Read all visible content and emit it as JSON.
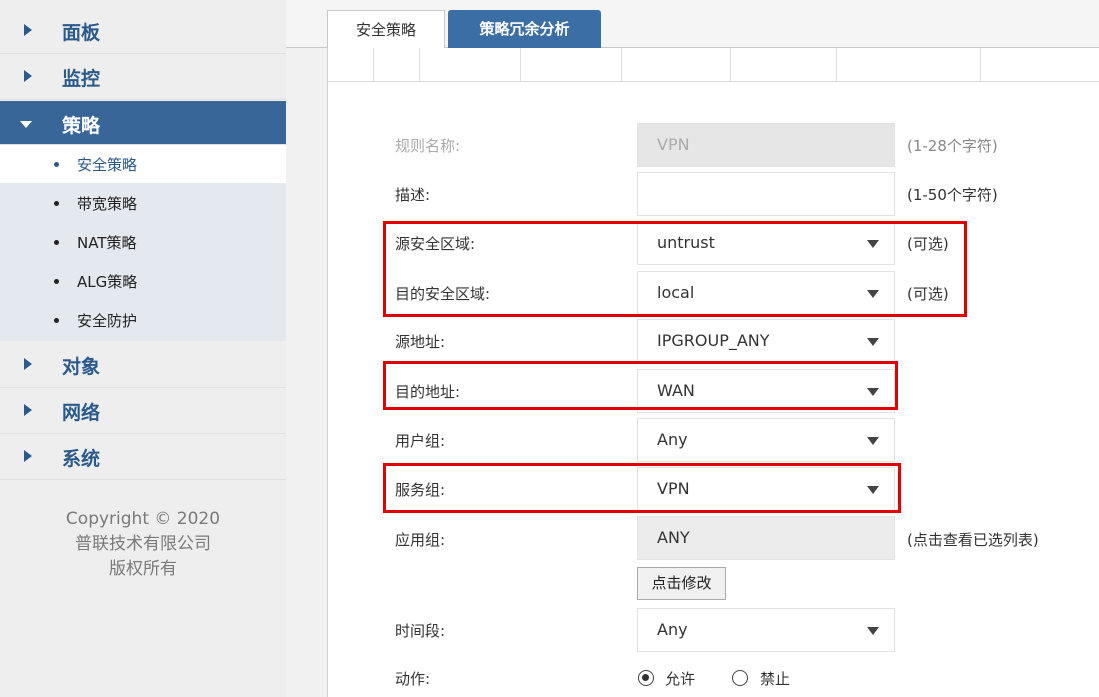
{
  "sidebar": {
    "menu": [
      {
        "label": "面板"
      },
      {
        "label": "监控"
      },
      {
        "label": "策略"
      },
      {
        "label": "对象"
      },
      {
        "label": "网络"
      },
      {
        "label": "系统"
      }
    ],
    "submenu": [
      {
        "label": "安全策略"
      },
      {
        "label": "带宽策略"
      },
      {
        "label": "NAT策略"
      },
      {
        "label": "ALG策略"
      },
      {
        "label": "安全防护"
      }
    ],
    "copyright": [
      "Copyright © 2020",
      "普联技术有限公司",
      "版权所有"
    ]
  },
  "tabs": [
    {
      "label": "安全策略"
    },
    {
      "label": "策略冗余分析"
    }
  ],
  "form": {
    "rule_name": {
      "label": "规则名称:",
      "value": "VPN",
      "hint": "(1-28个字符)"
    },
    "description": {
      "label": "描述:",
      "value": "",
      "hint": "(1-50个字符)"
    },
    "src_zone": {
      "label": "源安全区域:",
      "value": "untrust",
      "hint": "(可选)"
    },
    "dst_zone": {
      "label": "目的安全区域:",
      "value": "local",
      "hint": "(可选)"
    },
    "src_addr": {
      "label": "源地址:",
      "value": "IPGROUP_ANY"
    },
    "dst_addr": {
      "label": "目的地址:",
      "value": "WAN"
    },
    "user_group": {
      "label": "用户组:",
      "value": "Any"
    },
    "service_group": {
      "label": "服务组:",
      "value": "VPN"
    },
    "app_group": {
      "label": "应用组:",
      "value": "ANY",
      "hint": "(点击查看已选列表)"
    },
    "edit_button": "点击修改",
    "time_period": {
      "label": "时间段:",
      "value": "Any"
    },
    "action": {
      "label": "动作:",
      "options": [
        "允许",
        "禁止"
      ],
      "selected": "允许"
    }
  },
  "colors": {
    "accent": "#386698",
    "tab_active": "#3a6ea5",
    "highlight": "#e00000"
  }
}
